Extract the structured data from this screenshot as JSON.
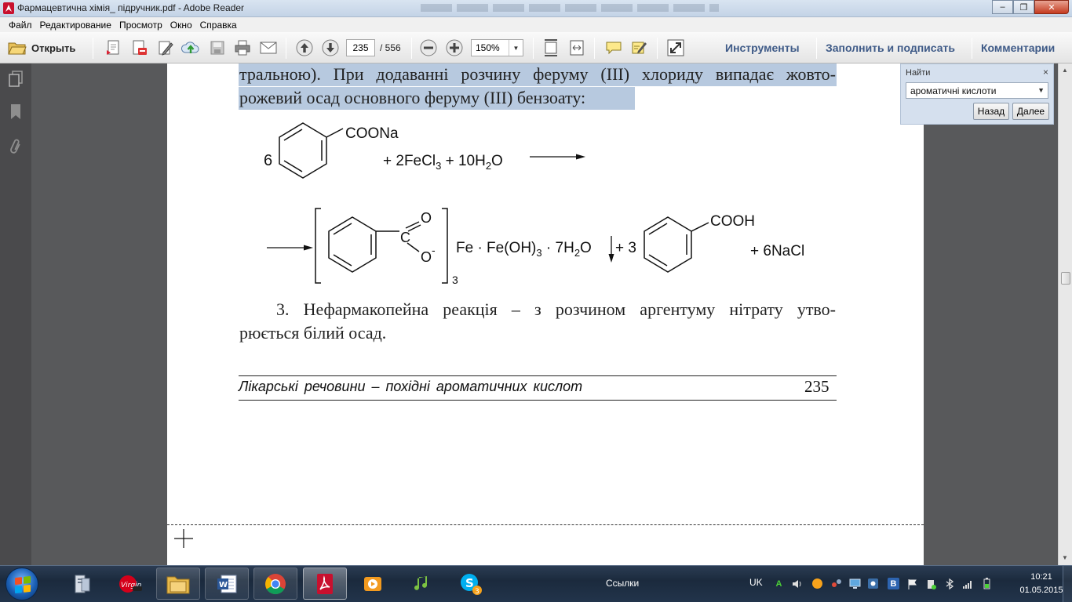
{
  "window": {
    "title": "Фармацевтична хімія_ підручник.pdf - Adobe Reader",
    "buttons": {
      "minimize": "‒",
      "maximize": "❐",
      "close": "✕"
    }
  },
  "menu": [
    "Файл",
    "Редактирование",
    "Просмотр",
    "Окно",
    "Справка"
  ],
  "toolbar": {
    "open_label": "Открыть",
    "page_current": "235",
    "page_total": "/ 556",
    "zoom": "150%",
    "links": {
      "tools": "Инструменты",
      "fill_sign": "Заполнить и подписать",
      "comments": "Комментарии"
    },
    "icons": [
      "open-folder-icon",
      "create-pdf-icon",
      "export-pdf-icon",
      "edit-icon",
      "upload-cloud-icon",
      "save-icon",
      "print-icon",
      "email-icon",
      "prev-page-icon",
      "next-page-icon",
      "zoom-out-icon",
      "zoom-in-icon",
      "fit-page-icon",
      "fit-width-icon",
      "comment-icon",
      "highlight-icon",
      "fullscreen-icon"
    ]
  },
  "find": {
    "title": "Найти",
    "close": "×",
    "query": "ароматичні кислоти",
    "back": "Назад",
    "next": "Далее"
  },
  "document": {
    "line1": "тральною). При додаванні розчину феруму (ІІІ) хлориду випадає жовто-",
    "line2": "рожевий осад основного феруму (ІІІ) бензоату:",
    "reaction1": {
      "coef": "6",
      "group": "COONa",
      "reagent_1": "+ 2FeCl",
      "reagent_1_sub": "3",
      "reagent_2": " + 10H",
      "reagent_2_sub": "2",
      "reagent_2_end": "O"
    },
    "reaction2": {
      "o_top": "O",
      "c_atom": "C",
      "o_bottom": "O",
      "minus": "-",
      "bracket_sub": "3",
      "product_a": "Fe · Fe(OH)",
      "product_a_sub": "3",
      "product_b": " · 7H",
      "product_b_sub": "2",
      "product_b_end": "O",
      "plus_coef": "+ 3",
      "group": "COOH",
      "salt": "+ 6NaCl"
    },
    "para3_line1": "3. Нефармакопейна реакція – з розчином аргентуму нітрату утво-",
    "para3_line2": "рюється білий осад.",
    "footer_title": "Лікарські речовини – похідні ароматичних кислот",
    "footer_page": "235"
  },
  "taskbar": {
    "links": "Ссылки",
    "lang": "UK",
    "time": "10:21",
    "date": "01.05.2015",
    "apps": [
      "file-manager-icon",
      "virgin-media-icon",
      "explorer-folder-icon",
      "word-icon",
      "chrome-icon",
      "adobe-reader-icon",
      "media-player-icon",
      "music-icon",
      "skype-icon"
    ],
    "skype_badge": "3",
    "tray": {
      "a": "A",
      "b": "B"
    }
  },
  "colors": {
    "highlight": "#b7c9df",
    "toolbar_link": "#3e5a87",
    "find_panel": "#d5e0ee",
    "taskbar": "#1b2a3d"
  }
}
